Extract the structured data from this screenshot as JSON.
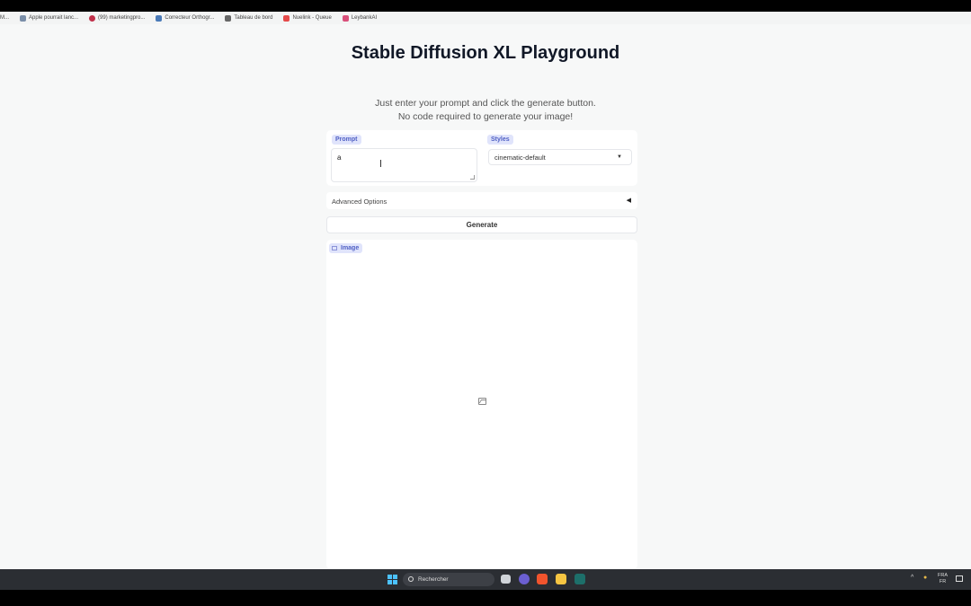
{
  "bookmarks": [
    {
      "label": "M...",
      "color": "#555555"
    },
    {
      "label": "Apple pourrait lanc...",
      "color": "#7a8ea8"
    },
    {
      "label": "(99) marketingpro...",
      "color": "#c0304a"
    },
    {
      "label": "Correcteur Orthogr...",
      "color": "#4a7ab8"
    },
    {
      "label": "Tableau de bord",
      "color": "#666666"
    },
    {
      "label": "Nuelink - Queue",
      "color": "#e54a4a"
    },
    {
      "label": "LeybankAI",
      "color": "#d94f7a"
    }
  ],
  "header": {
    "title": "Stable Diffusion XL Playground",
    "subtitle_line1": "Just enter your prompt and click the generate button.",
    "subtitle_line2": "No code required to generate your image!"
  },
  "prompt": {
    "label": "Prompt",
    "value": "a"
  },
  "styles": {
    "label": "Styles",
    "selected": "cinematic-default"
  },
  "advanced": {
    "label": "Advanced Options",
    "arrow": "◀"
  },
  "generate": {
    "label": "Generate"
  },
  "output": {
    "label": "Image",
    "icon": "image-placeholder-icon"
  },
  "taskbar": {
    "search_placeholder": "Rechercher",
    "lang_top": "FRA",
    "lang_bottom": "FR",
    "accent": "#4cc2ff"
  }
}
